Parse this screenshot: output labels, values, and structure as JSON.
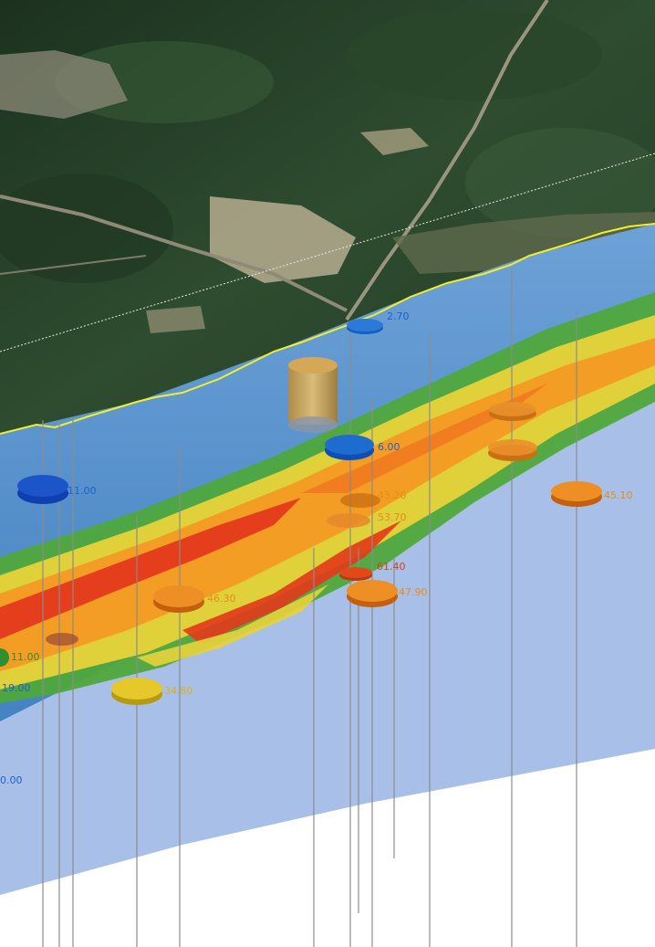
{
  "scene": {
    "colors": {
      "forest_dark": "#1d3320",
      "forest": "#2f4f30",
      "clearing": "#b7ad8f",
      "road": "#8f8a78",
      "surface_line": "#f4ee2a",
      "water_blue": "#5b8fc9",
      "basement": "#a8c0e8",
      "mid_blue": "#4e86c4",
      "green": "#4fa83c",
      "yellow": "#e8d23a",
      "orange": "#f39a24",
      "red": "#e3391b",
      "borehole_line": "#8c8c8c"
    }
  },
  "markers": [
    {
      "label": "2.70",
      "color": "blue"
    },
    {
      "label": "6.00",
      "color": "blue"
    },
    {
      "label": "11.00",
      "color": "blue"
    },
    {
      "label": "43.20",
      "color": "orange"
    },
    {
      "label": "53.70",
      "color": "orange"
    },
    {
      "label": "45.10",
      "color": "orange"
    },
    {
      "label": "46.30",
      "color": "orange"
    },
    {
      "label": "61.40",
      "color": "red"
    },
    {
      "label": "47.90",
      "color": "orange"
    },
    {
      "label": "11.00",
      "color": "green"
    },
    {
      "label": "19.00",
      "color": "blue"
    },
    {
      "label": "34.80",
      "color": "yellow"
    },
    {
      "label": "0.00",
      "color": "blue"
    }
  ]
}
